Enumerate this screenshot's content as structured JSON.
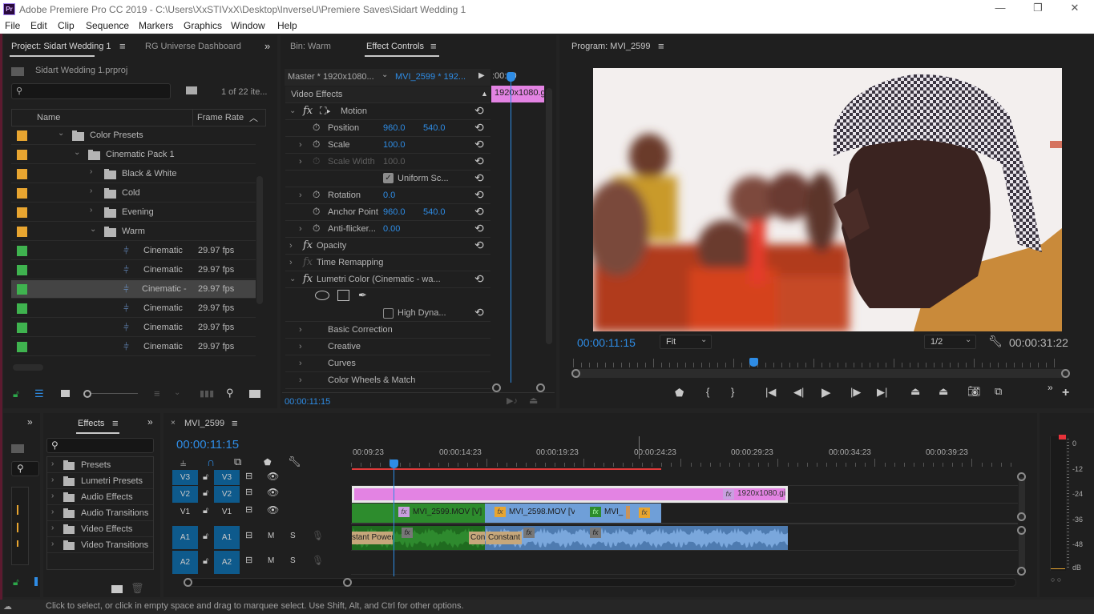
{
  "window": {
    "app_icon": "Pr",
    "title": "Adobe Premiere Pro CC 2019 - C:\\Users\\XxSTIVxX\\Desktop\\InverseU\\Premiere Saves\\Sidart Wedding 1",
    "minimize": "—",
    "restore": "❐",
    "close": "✕"
  },
  "menu": [
    "File",
    "Edit",
    "Clip",
    "Sequence",
    "Markers",
    "Graphics",
    "Window",
    "Help"
  ],
  "project_panel": {
    "tabs": [
      "Project: Sidart Wedding 1",
      "RG Universe Dashboard"
    ],
    "overflow": "»",
    "project_file": "Sidart Wedding 1.prproj",
    "search_placeholder": "",
    "item_count": "1 of 22 ite...",
    "columns": {
      "name": "Name",
      "frame_rate": "Frame Rate"
    },
    "rows": [
      {
        "label": "Color Presets",
        "type": "folder",
        "expanded": true,
        "color": "#e8a530",
        "fps": ""
      },
      {
        "label": "Cinematic Pack 1",
        "type": "folder",
        "expanded": true,
        "color": "#e8a530",
        "fps": ""
      },
      {
        "label": "Black & White",
        "type": "folder",
        "expanded": false,
        "color": "#e8a530",
        "fps": ""
      },
      {
        "label": "Cold",
        "type": "folder",
        "expanded": false,
        "color": "#e8a530",
        "fps": ""
      },
      {
        "label": "Evening",
        "type": "folder",
        "expanded": false,
        "color": "#e8a530",
        "fps": ""
      },
      {
        "label": "Warm",
        "type": "folder",
        "expanded": true,
        "color": "#e8a530",
        "fps": ""
      },
      {
        "label": "Cinematic",
        "type": "sequence",
        "color": "#3fb34f",
        "fps": "29.97 fps"
      },
      {
        "label": "Cinematic",
        "type": "sequence",
        "color": "#3fb34f",
        "fps": "29.97 fps"
      },
      {
        "label": "Cinematic -",
        "type": "sequence",
        "color": "#3fb34f",
        "fps": "29.97 fps",
        "selected": true
      },
      {
        "label": "Cinematic",
        "type": "sequence",
        "color": "#3fb34f",
        "fps": "29.97 fps"
      },
      {
        "label": "Cinematic",
        "type": "sequence",
        "color": "#3fb34f",
        "fps": "29.97 fps"
      },
      {
        "label": "Cinematic",
        "type": "sequence",
        "color": "#3fb34f",
        "fps": "29.97 fps"
      }
    ]
  },
  "effect_controls": {
    "tabs": [
      "Bin: Warm",
      "Effect Controls"
    ],
    "master_label": "Master * 1920x1080...",
    "clip_label": "MVI_2599 * 192...",
    "mini_timecode": ":00:00",
    "mini_clip": "1920x1080.g",
    "section": "Video Effects",
    "motion": "Motion",
    "position": {
      "label": "Position",
      "x": "960.0",
      "y": "540.0"
    },
    "scale": {
      "label": "Scale",
      "value": "100.0"
    },
    "scale_width": {
      "label": "Scale Width",
      "value": "100.0"
    },
    "uniform_scale": {
      "label": "Uniform Sc...",
      "checked": true
    },
    "rotation": {
      "label": "Rotation",
      "value": "0.0"
    },
    "anchor_point": {
      "label": "Anchor Point",
      "x": "960.0",
      "y": "540.0"
    },
    "anti_flicker": {
      "label": "Anti-flicker...",
      "value": "0.00"
    },
    "opacity": "Opacity",
    "time_remapping": "Time Remapping",
    "lumetri": "Lumetri Color (Cinematic - wa...",
    "high_dynamic": {
      "label": "High Dyna...",
      "checked": false
    },
    "subsections": [
      "Basic Correction",
      "Creative",
      "Curves",
      "Color Wheels & Match"
    ],
    "timecode": "00:00:11:15"
  },
  "program_monitor": {
    "title": "Program: MVI_2599",
    "timecode": "00:00:11:15",
    "zoom": "Fit",
    "resolution": "1/2",
    "duration": "00:00:31:22",
    "playhead_fraction": 0.36
  },
  "effects_panel": {
    "tab": "Effects",
    "search_placeholder": "",
    "items": [
      "Presets",
      "Lumetri Presets",
      "Audio Effects",
      "Audio Transitions",
      "Video Effects",
      "Video Transitions"
    ]
  },
  "timeline": {
    "sequence": "MVI_2599",
    "timecode": "00:00:11:15",
    "ruler": [
      "00:09:23",
      "00:00:14:23",
      "00:00:19:23",
      "00:00:24:23",
      "00:00:29:23",
      "00:00:34:23",
      "00:00:39:23"
    ],
    "tracks": {
      "video": [
        "V3",
        "V2",
        "V1"
      ],
      "audio": [
        "A1",
        "A2"
      ],
      "mute": "M",
      "solo": "S"
    },
    "clips": {
      "v2": "1920x1080.gi",
      "v1": [
        "MVI_2599.MOV [V]",
        "MVI_2598.MOV [V] [",
        "MVI_"
      ],
      "a1_transitions": [
        "stant Power",
        "Cons",
        "Constant P"
      ]
    },
    "fx": "fx"
  },
  "audio_meter": {
    "labels": [
      "0",
      "-12",
      "-24",
      "-36",
      "-48",
      "dB"
    ],
    "solo_buttons": "○ ○"
  },
  "status": "Click to select, or click in empty space and drag to marquee select. Use Shift, Alt, and Ctrl for other options.",
  "colors": {
    "accent": "#2e8ce5",
    "video_clip_green": "#2d8c2d",
    "video_clip_blue": "#6f9fd8",
    "graphic_clip": "#e383e3",
    "track_target": "#0e5a8c"
  }
}
